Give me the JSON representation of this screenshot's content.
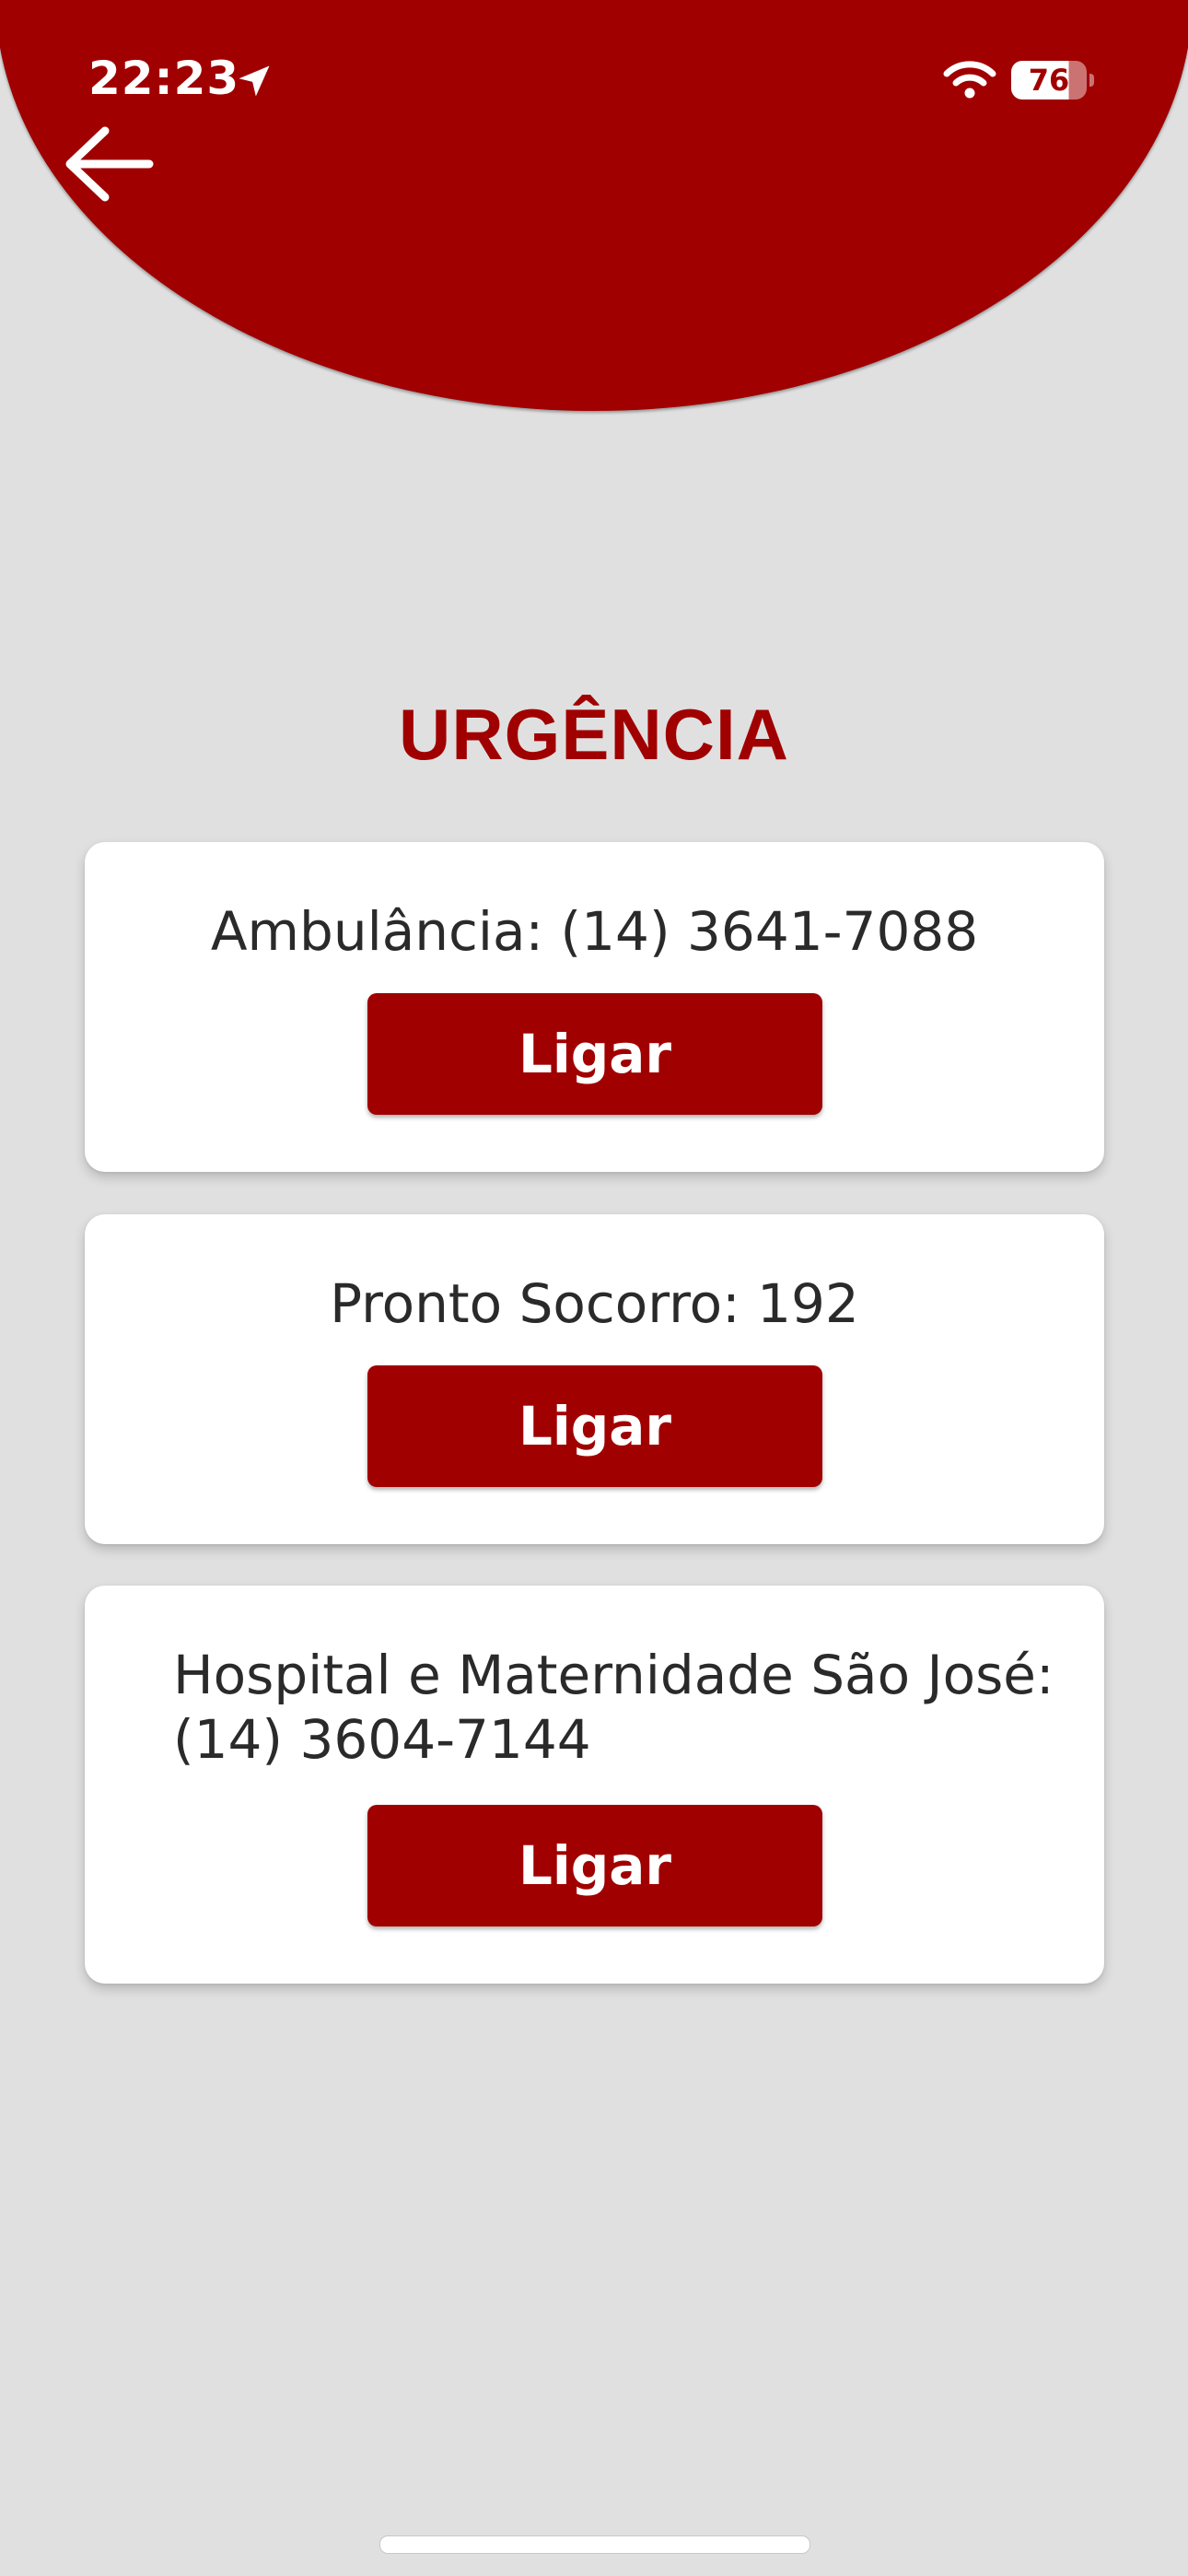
{
  "status_bar": {
    "time": "22:23",
    "battery": "76",
    "icons": [
      "location-arrow-icon",
      "wifi-icon",
      "battery-icon"
    ]
  },
  "header": {
    "back_icon": "arrow-left-icon",
    "accent_color": "#a00000"
  },
  "main": {
    "title": "URGÊNCIA",
    "contacts": [
      {
        "text": "Ambulância: (14) 3641-7088",
        "button_label": "Ligar"
      },
      {
        "text": "Pronto Socorro: 192",
        "button_label": "Ligar"
      },
      {
        "text_line1": "Hospital e Maternidade São José:",
        "text_line2": "(14) 3604-7144",
        "button_label": "Ligar"
      }
    ]
  },
  "colors": {
    "background": "#e0e0e0",
    "primary": "#a00000",
    "card": "#ffffff",
    "text": "#2a2a2a"
  }
}
